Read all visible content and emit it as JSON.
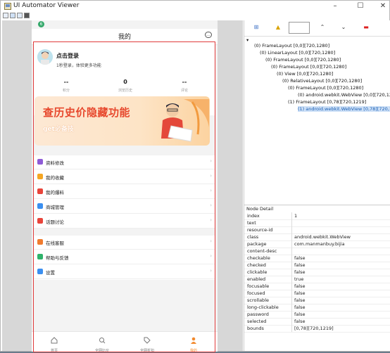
{
  "window": {
    "title": "UI Automator Viewer"
  },
  "device": {
    "status_badge": "6",
    "nav_title": "我的",
    "profile": {
      "login_title": "点击登录",
      "login_sub": "1秒登录，体验更多功能",
      "stats": [
        {
          "value": "--",
          "label": "积分"
        },
        {
          "value": "0",
          "label": "浏览历史"
        },
        {
          "value": "--",
          "label": "评论"
        }
      ]
    },
    "banner": {
      "title": "查历史价隐藏功能",
      "subtitle": "get必备技"
    },
    "menu_group1": [
      {
        "label": "资料修改",
        "icon": "edit-profile-icon",
        "color": "#8e5bd6"
      },
      {
        "label": "我的收藏",
        "icon": "favorite-icon",
        "color": "#f5a623"
      },
      {
        "label": "我的爆料",
        "icon": "deals-icon",
        "color": "#e8443a"
      },
      {
        "label": "商城管理",
        "icon": "store-icon",
        "color": "#3b8ff0"
      },
      {
        "label": "话题讨论",
        "icon": "topic-icon",
        "color": "#e8443a"
      }
    ],
    "menu_group2": [
      {
        "label": "在线客服",
        "icon": "support-icon",
        "color": "#f07b2e"
      },
      {
        "label": "帮助与反馈",
        "icon": "help-icon",
        "color": "#2fb36b"
      },
      {
        "label": "设置",
        "icon": "settings-icon",
        "color": "#3b8ff0"
      }
    ],
    "tabs": [
      {
        "label": "首页",
        "icon": "home-icon"
      },
      {
        "label": "全网比价",
        "icon": "search-icon"
      },
      {
        "label": "全网折扣",
        "icon": "tag-icon"
      },
      {
        "label": "我的",
        "icon": "user-icon"
      }
    ]
  },
  "tree": [
    {
      "text": "(0) FrameLayout [0,0][720,1280]"
    },
    {
      "text": "(0) LinearLayout [0,0][720,1280]"
    },
    {
      "text": "(0) FrameLayout [0,0][720,1280]"
    },
    {
      "text": "(0) FrameLayout [0,0][720,1280]"
    },
    {
      "text": "(0) View [0,0][720,1280]"
    },
    {
      "text": "(0) RelativeLayout [0,0][720,1280]"
    },
    {
      "text": "(0) FrameLayout [0,0][720,1280]"
    },
    {
      "text": "(0) android.webkit.WebView [0,0][720,12"
    },
    {
      "text": "(1) FrameLayout [0,78][720,1219]"
    },
    {
      "text": "(1) android.webkit.WebView [0,78][720,1"
    }
  ],
  "detail": {
    "heading": "Node Detail",
    "props": [
      {
        "k": "index",
        "v": "1"
      },
      {
        "k": "text",
        "v": ""
      },
      {
        "k": "resource-id",
        "v": ""
      },
      {
        "k": "class",
        "v": "android.webkit.WebView"
      },
      {
        "k": "package",
        "v": "com.manmanbuy.bijia"
      },
      {
        "k": "content-desc",
        "v": ""
      },
      {
        "k": "checkable",
        "v": "false"
      },
      {
        "k": "checked",
        "v": "false"
      },
      {
        "k": "clickable",
        "v": "false"
      },
      {
        "k": "enabled",
        "v": "true"
      },
      {
        "k": "focusable",
        "v": "false"
      },
      {
        "k": "focused",
        "v": "false"
      },
      {
        "k": "scrollable",
        "v": "false"
      },
      {
        "k": "long-clickable",
        "v": "false"
      },
      {
        "k": "password",
        "v": "false"
      },
      {
        "k": "selected",
        "v": "false"
      },
      {
        "k": "bounds",
        "v": "[0,78][720,1219]"
      }
    ]
  }
}
